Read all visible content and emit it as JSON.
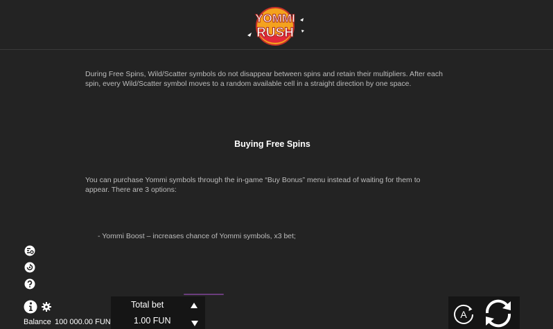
{
  "header": {
    "logo": {
      "line1": "YOMMI",
      "line2": "RUSH",
      "icon": "yommi-rush-logo"
    }
  },
  "rules": {
    "paragraph_free_spins": "During Free Spins, Wild/Scatter symbols do not disappear between spins and retain their multipliers. After each spin, every Wild/Scatter symbol moves to a random available cell in a straight direction by one space.",
    "heading_buying": "Buying Free Spins",
    "paragraph_buy": "You can purchase Yommi symbols through the in-game “Buy Bonus” menu instead of waiting for them to appear. There are 3 options:",
    "option_1": "- Yommi Boost – increases chance of Yommi symbols, x3 bet;"
  },
  "side_icons": [
    "paytable-icon",
    "history-icon",
    "help-icon"
  ],
  "footer": {
    "balance_label": "Balance",
    "balance_value": "100 000.00 FUN",
    "bet_label": "Total bet",
    "bet_value": "1.00 FUN",
    "auto_label": "A"
  },
  "colors": {
    "background": "#232323",
    "panel": "#151515",
    "text": "#bdbdbd",
    "accent": "#6a3d7d",
    "logo_orange": "#f4a21e",
    "logo_red": "#e2283a"
  }
}
